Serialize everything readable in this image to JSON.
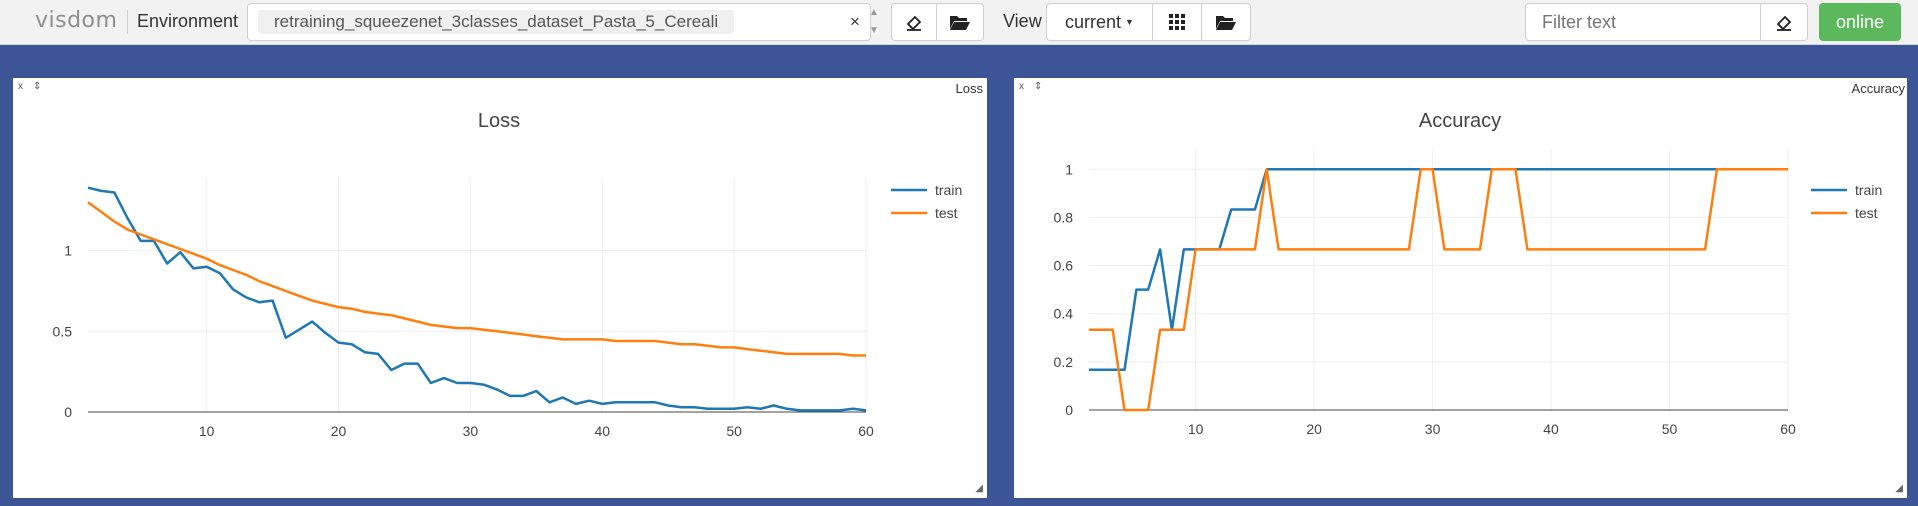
{
  "toolbar": {
    "brand": "visdom",
    "environment_label": "Environment",
    "environment_value": "retraining_squeezenet_3classes_dataset_Pasta_5_Cereali",
    "clear_symbol": "×",
    "view_label": "View",
    "view_value": "current",
    "filter_placeholder": "Filter text",
    "status": "online",
    "status_color": "#5cb85c",
    "icons": [
      "eraser-icon",
      "folder-open-icon",
      "grid-icon",
      "folder-open-icon",
      "eraser-icon"
    ]
  },
  "panes": [
    {
      "window_title": "Loss",
      "close": "x",
      "pin": "⇕",
      "chart_data": {
        "type": "line",
        "title": "Loss",
        "xlim": [
          1,
          60
        ],
        "ylim": [
          0,
          1.45
        ],
        "xticks": [
          10,
          20,
          30,
          40,
          50,
          60
        ],
        "yticks": [
          0,
          0.5,
          1
        ],
        "ytick_labels": [
          "0",
          "0.5",
          "1"
        ],
        "legend_position": "right",
        "grid": true,
        "series": [
          {
            "name": "train",
            "color": "#1f77b4",
            "values": [
              1.39,
              1.37,
              1.36,
              1.2,
              1.06,
              1.06,
              0.92,
              0.99,
              0.89,
              0.9,
              0.86,
              0.76,
              0.71,
              0.68,
              0.69,
              0.46,
              0.51,
              0.56,
              0.49,
              0.43,
              0.42,
              0.37,
              0.36,
              0.26,
              0.3,
              0.3,
              0.18,
              0.21,
              0.18,
              0.18,
              0.17,
              0.14,
              0.1,
              0.1,
              0.13,
              0.06,
              0.09,
              0.05,
              0.07,
              0.05,
              0.06,
              0.06,
              0.06,
              0.06,
              0.04,
              0.03,
              0.03,
              0.02,
              0.02,
              0.02,
              0.03,
              0.02,
              0.04,
              0.02,
              0.01,
              0.01,
              0.01,
              0.01,
              0.02,
              0.01
            ]
          },
          {
            "name": "test",
            "color": "#ff7f0e",
            "values": [
              1.3,
              1.24,
              1.18,
              1.13,
              1.1,
              1.07,
              1.04,
              1.01,
              0.98,
              0.95,
              0.91,
              0.88,
              0.85,
              0.81,
              0.78,
              0.75,
              0.72,
              0.69,
              0.67,
              0.65,
              0.64,
              0.62,
              0.61,
              0.6,
              0.58,
              0.56,
              0.54,
              0.53,
              0.52,
              0.52,
              0.51,
              0.5,
              0.49,
              0.48,
              0.47,
              0.46,
              0.45,
              0.45,
              0.45,
              0.45,
              0.44,
              0.44,
              0.44,
              0.44,
              0.43,
              0.42,
              0.42,
              0.41,
              0.4,
              0.4,
              0.39,
              0.38,
              0.37,
              0.36,
              0.36,
              0.36,
              0.36,
              0.36,
              0.35,
              0.35
            ]
          }
        ]
      }
    },
    {
      "window_title": "Accuracy",
      "close": "x",
      "pin": "⇕",
      "chart_data": {
        "type": "line",
        "title": "Accuracy",
        "xlim": [
          1,
          60
        ],
        "ylim": [
          0,
          1.08
        ],
        "xticks": [
          10,
          20,
          30,
          40,
          50,
          60
        ],
        "yticks": [
          0,
          0.2,
          0.4,
          0.6,
          0.8,
          1
        ],
        "ytick_labels": [
          "0",
          "0.2",
          "0.4",
          "0.6",
          "0.8",
          "1"
        ],
        "legend_position": "right",
        "grid": true,
        "series": [
          {
            "name": "train",
            "color": "#1f77b4",
            "values": [
              0.167,
              0.167,
              0.167,
              0.167,
              0.5,
              0.5,
              0.667,
              0.333,
              0.667,
              0.667,
              0.667,
              0.667,
              0.833,
              0.833,
              0.833,
              1,
              1,
              1,
              1,
              1,
              1,
              1,
              1,
              1,
              1,
              1,
              1,
              1,
              1,
              1,
              1,
              1,
              1,
              1,
              1,
              1,
              1,
              1,
              1,
              1,
              1,
              1,
              1,
              1,
              1,
              1,
              1,
              1,
              1,
              1,
              1,
              1,
              1,
              1,
              1,
              1,
              1,
              1,
              1,
              1
            ]
          },
          {
            "name": "test",
            "color": "#ff7f0e",
            "values": [
              0.333,
              0.333,
              0.333,
              0,
              0,
              0,
              0.333,
              0.333,
              0.333,
              0.667,
              0.667,
              0.667,
              0.667,
              0.667,
              0.667,
              1,
              0.667,
              0.667,
              0.667,
              0.667,
              0.667,
              0.667,
              0.667,
              0.667,
              0.667,
              0.667,
              0.667,
              0.667,
              1,
              1,
              0.667,
              0.667,
              0.667,
              0.667,
              1,
              1,
              1,
              0.667,
              0.667,
              0.667,
              0.667,
              0.667,
              0.667,
              0.667,
              0.667,
              0.667,
              0.667,
              0.667,
              0.667,
              0.667,
              0.667,
              0.667,
              0.667,
              1,
              1,
              1,
              1,
              1,
              1,
              1
            ]
          }
        ]
      }
    }
  ]
}
